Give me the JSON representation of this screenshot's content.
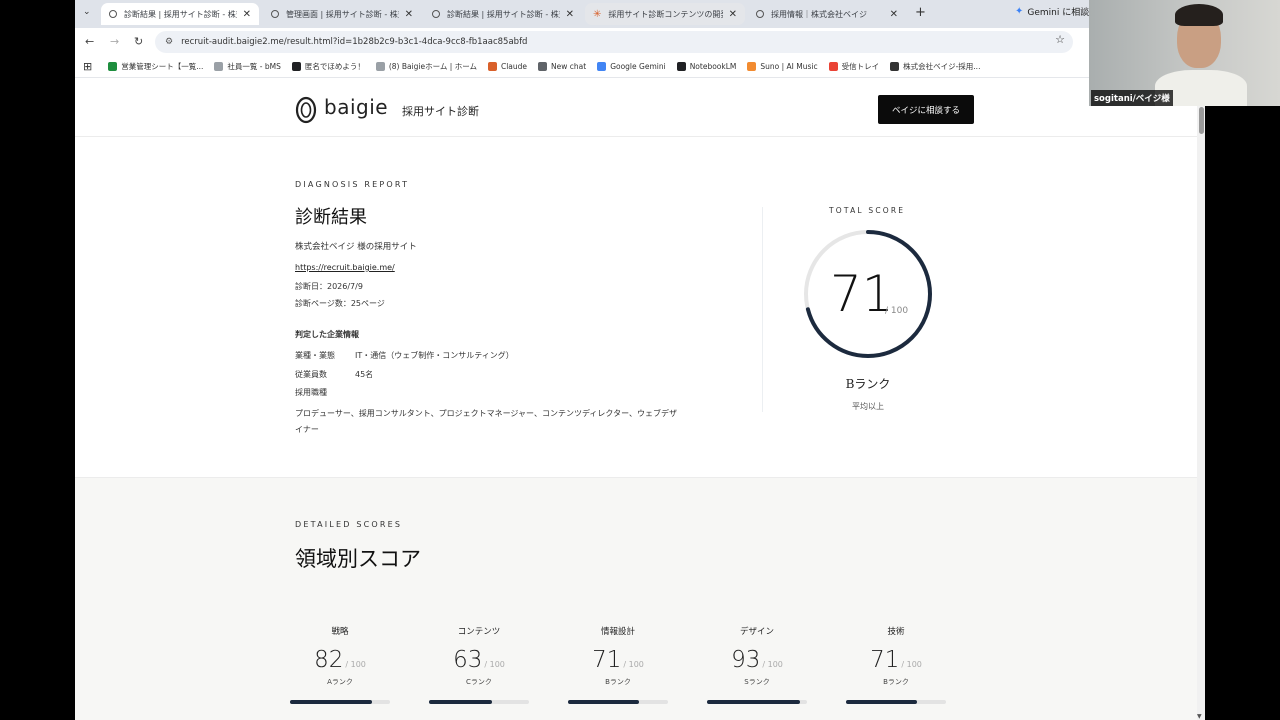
{
  "browser": {
    "tabs": [
      {
        "label": "診断結果 | 採用サイト診断 - 株式",
        "active": true
      },
      {
        "label": "管理画面 | 採用サイト診断 - 株式"
      },
      {
        "label": "診断結果 | 採用サイト診断 - 株式"
      },
      {
        "label": "採用サイト診断コンテンツの開発 -",
        "highlight": true
      },
      {
        "label": "採用情報｜株式会社ベイジ"
      }
    ],
    "gemini_chip": "Gemini に相談",
    "url": "recruit-audit.baigie2.me/result.html?id=1b28b2c9-b3c1-4dca-9cc8-fb1aac85abfd",
    "bookmarks": [
      {
        "label": "営業管理シート【一覧...",
        "color": "#1e8e3e"
      },
      {
        "label": "社員一覧 - bMS",
        "color": "#9aa0a6"
      },
      {
        "label": "匿名でほめよう！",
        "color": "#202124"
      },
      {
        "label": "(8) Baigieホーム | ホーム",
        "color": "#9aa0a6"
      },
      {
        "label": "Claude",
        "color": "#d9602a"
      },
      {
        "label": "New chat",
        "color": "#5f6368"
      },
      {
        "label": "Google Gemini",
        "color": "#4285f4"
      },
      {
        "label": "NotebookLM",
        "color": "#202124"
      },
      {
        "label": "Suno | AI Music",
        "color": "#f28b30"
      },
      {
        "label": "受信トレイ",
        "color": "#ea4335"
      },
      {
        "label": "株式会社ベイジ-採用...",
        "color": "#333333"
      }
    ]
  },
  "site": {
    "logo": "baigie",
    "subtitle": "採用サイト診断",
    "cta": "ベイジに相談する"
  },
  "report": {
    "eyebrow": "DIAGNOSIS REPORT",
    "title": "診断結果",
    "company_site": "株式会社ベイジ 様の採用サイト",
    "url": "https://recruit.baigie.me/",
    "date": "診断日：2026/7/9",
    "pages": "診断ページ数：25ページ",
    "company_heading": "判定した企業情報",
    "industry_label": "業種・業態",
    "industry_value": "IT・通信（ウェブ制作・コンサルティング）",
    "employees_label": "従業員数",
    "employees_value": "45名",
    "roles_label": "採用職種",
    "roles_line1": "プロデューサー、採用コンサルタント、プロジェクトマネージャー、コンテンツディレクター、ウェブデザ",
    "roles_line2": "イナー"
  },
  "total": {
    "label": "TOTAL SCORE",
    "score": "71",
    "score_fraction": 0.71,
    "max": "/ 100",
    "rank": "Bランク",
    "note": "平均以上"
  },
  "detailed": {
    "eyebrow": "DETAILED SCORES",
    "title": "領域別スコア",
    "categories": [
      {
        "label": "戦略",
        "score": "82",
        "max": "/ 100",
        "rank": "Aランク",
        "fraction": 0.82
      },
      {
        "label": "コンテンツ",
        "score": "63",
        "max": "/ 100",
        "rank": "Cランク",
        "fraction": 0.63
      },
      {
        "label": "情報設計",
        "score": "71",
        "max": "/ 100",
        "rank": "Bランク",
        "fraction": 0.71
      },
      {
        "label": "デザイン",
        "score": "93",
        "max": "/ 100",
        "rank": "Sランク",
        "fraction": 0.93
      },
      {
        "label": "技術",
        "score": "71",
        "max": "/ 100",
        "rank": "Bランク",
        "fraction": 0.71
      }
    ]
  },
  "video": {
    "name": "sogitani/ベイジ様"
  },
  "colors": {
    "accent": "#1c2a3e",
    "cta_bg": "#0b0b0b"
  }
}
